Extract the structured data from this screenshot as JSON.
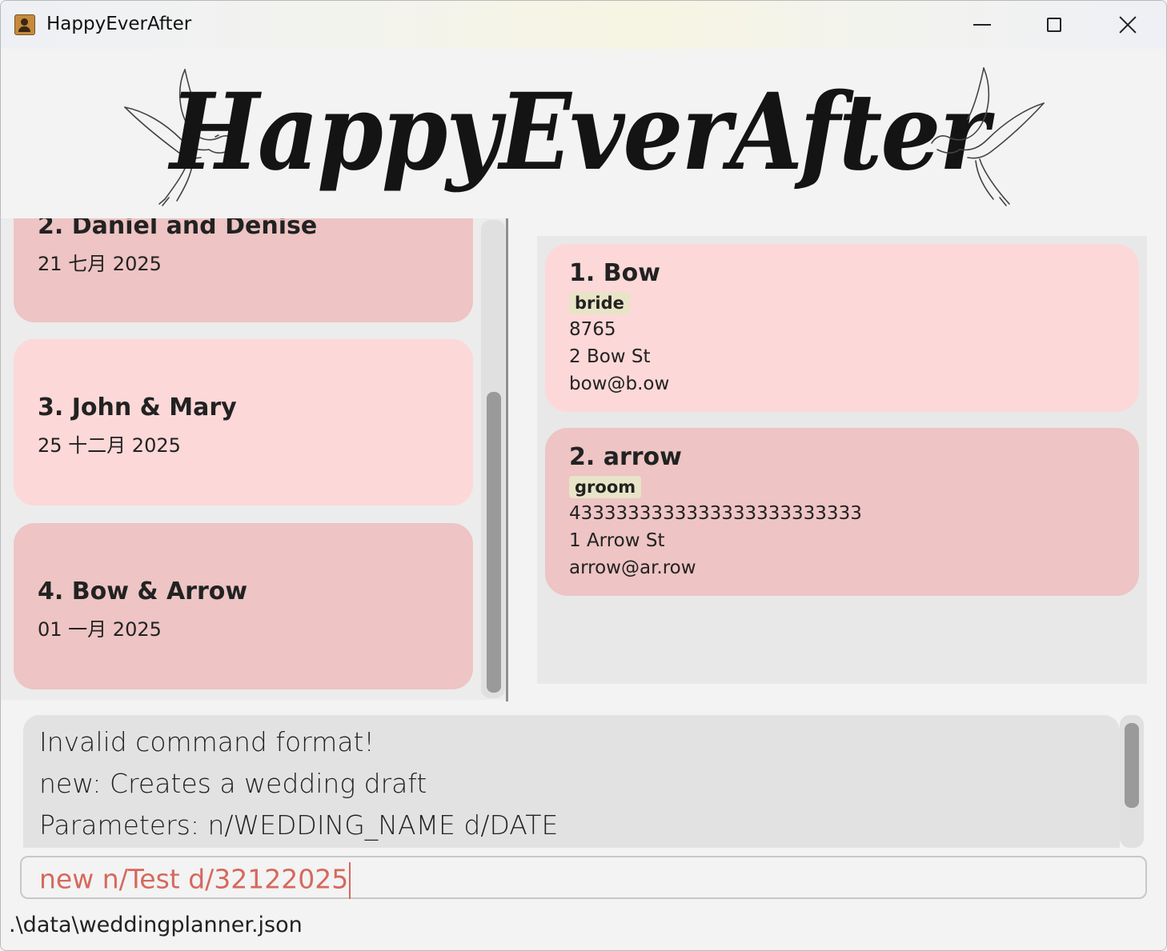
{
  "window": {
    "title": "HappyEverAfter"
  },
  "banner": {
    "logo_text": "HappyEverAfter"
  },
  "weddings": [
    {
      "name": "2. Daniel and Denise",
      "date": "21 七月 2025"
    },
    {
      "name": "3. John & Mary",
      "date": "25 十二月 2025"
    },
    {
      "name": "4. Bow & Arrow",
      "date": "01 一月 2025"
    }
  ],
  "persons": [
    {
      "name": "1. Bow",
      "tag": "bride",
      "phone": "8765",
      "address": "2 Bow St",
      "email": "bow@b.ow"
    },
    {
      "name": "2. arrow",
      "tag": "groom",
      "phone": "4333333333333333333333333",
      "address": "1 Arrow St",
      "email": "arrow@ar.row"
    }
  ],
  "result": {
    "lines": [
      "Invalid command format!",
      "new: Creates a wedding draft",
      "Parameters: n/WEDDING_NAME d/DATE"
    ]
  },
  "command": {
    "value": "new n/Test d/32122025"
  },
  "status": {
    "path": ".\\data\\weddingplanner.json"
  },
  "colors": {
    "card_dark": "#eec4c4",
    "card_light": "#fdd8d8",
    "tag_bg": "#e8e4c7",
    "command_text": "#d5695d"
  }
}
